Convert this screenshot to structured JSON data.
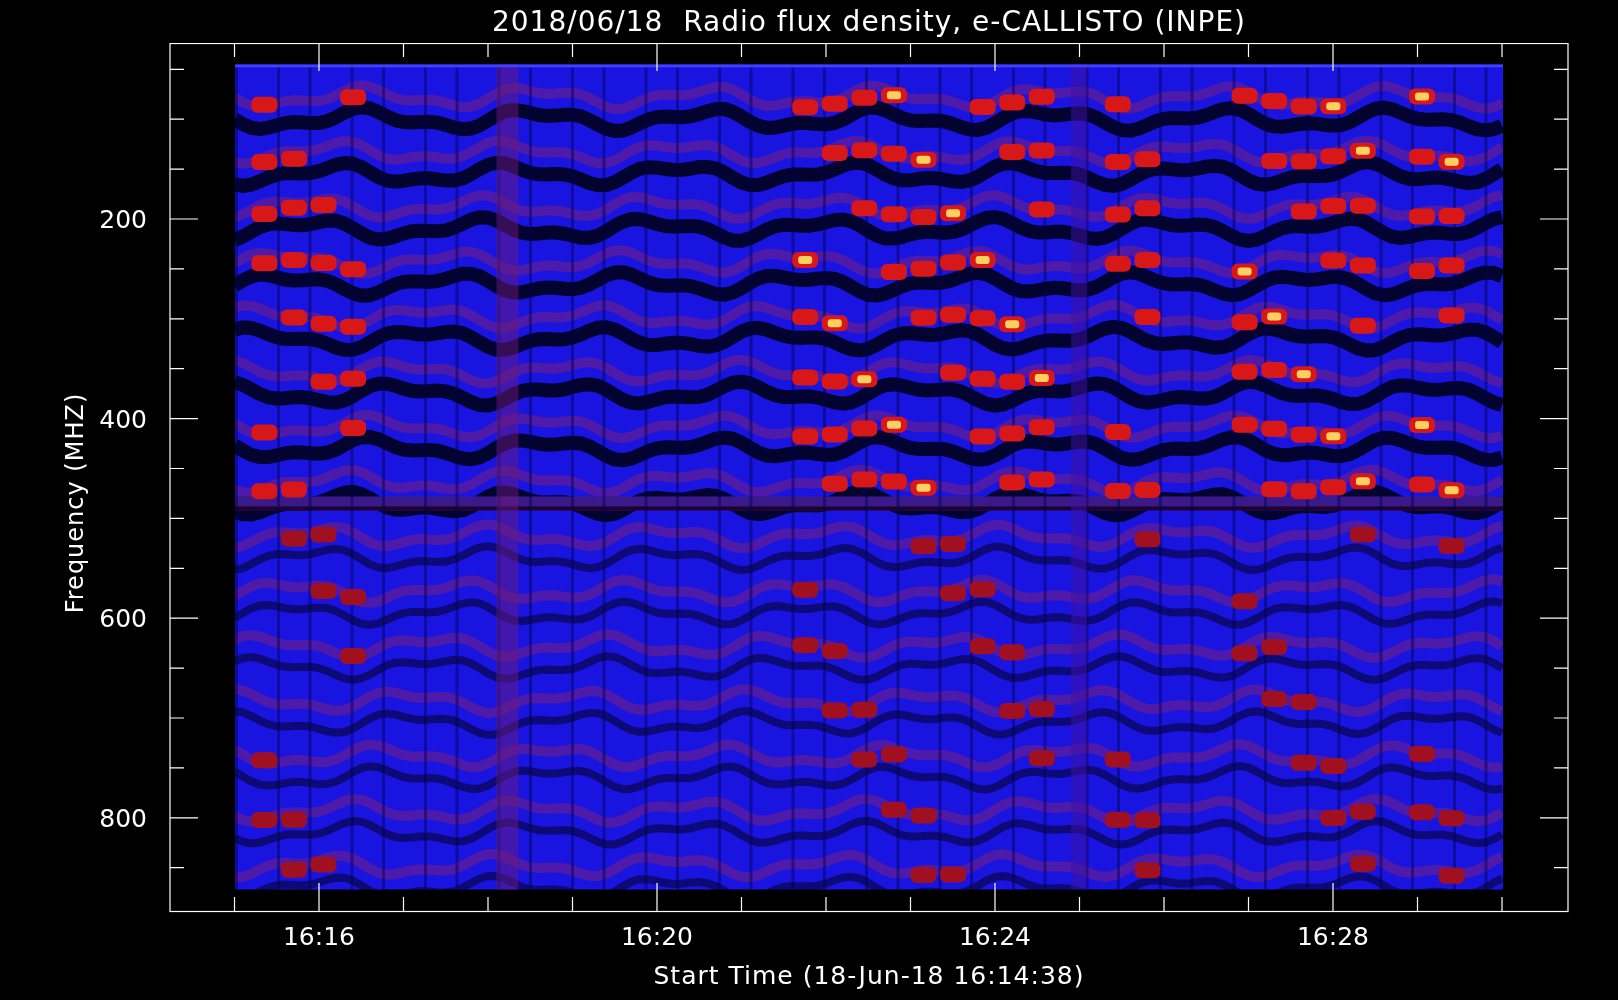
{
  "title": "2018/06/18  Radio flux density, e-CALLISTO (INPE)",
  "y_axis": {
    "label": "Frequency (MHZ)",
    "ticks": [
      "200",
      "400",
      "600",
      "800"
    ]
  },
  "x_axis": {
    "label": "Start Time (18-Jun-18 16:14:38)",
    "ticks": [
      "16:16",
      "16:20",
      "16:24",
      "16:28"
    ]
  }
}
